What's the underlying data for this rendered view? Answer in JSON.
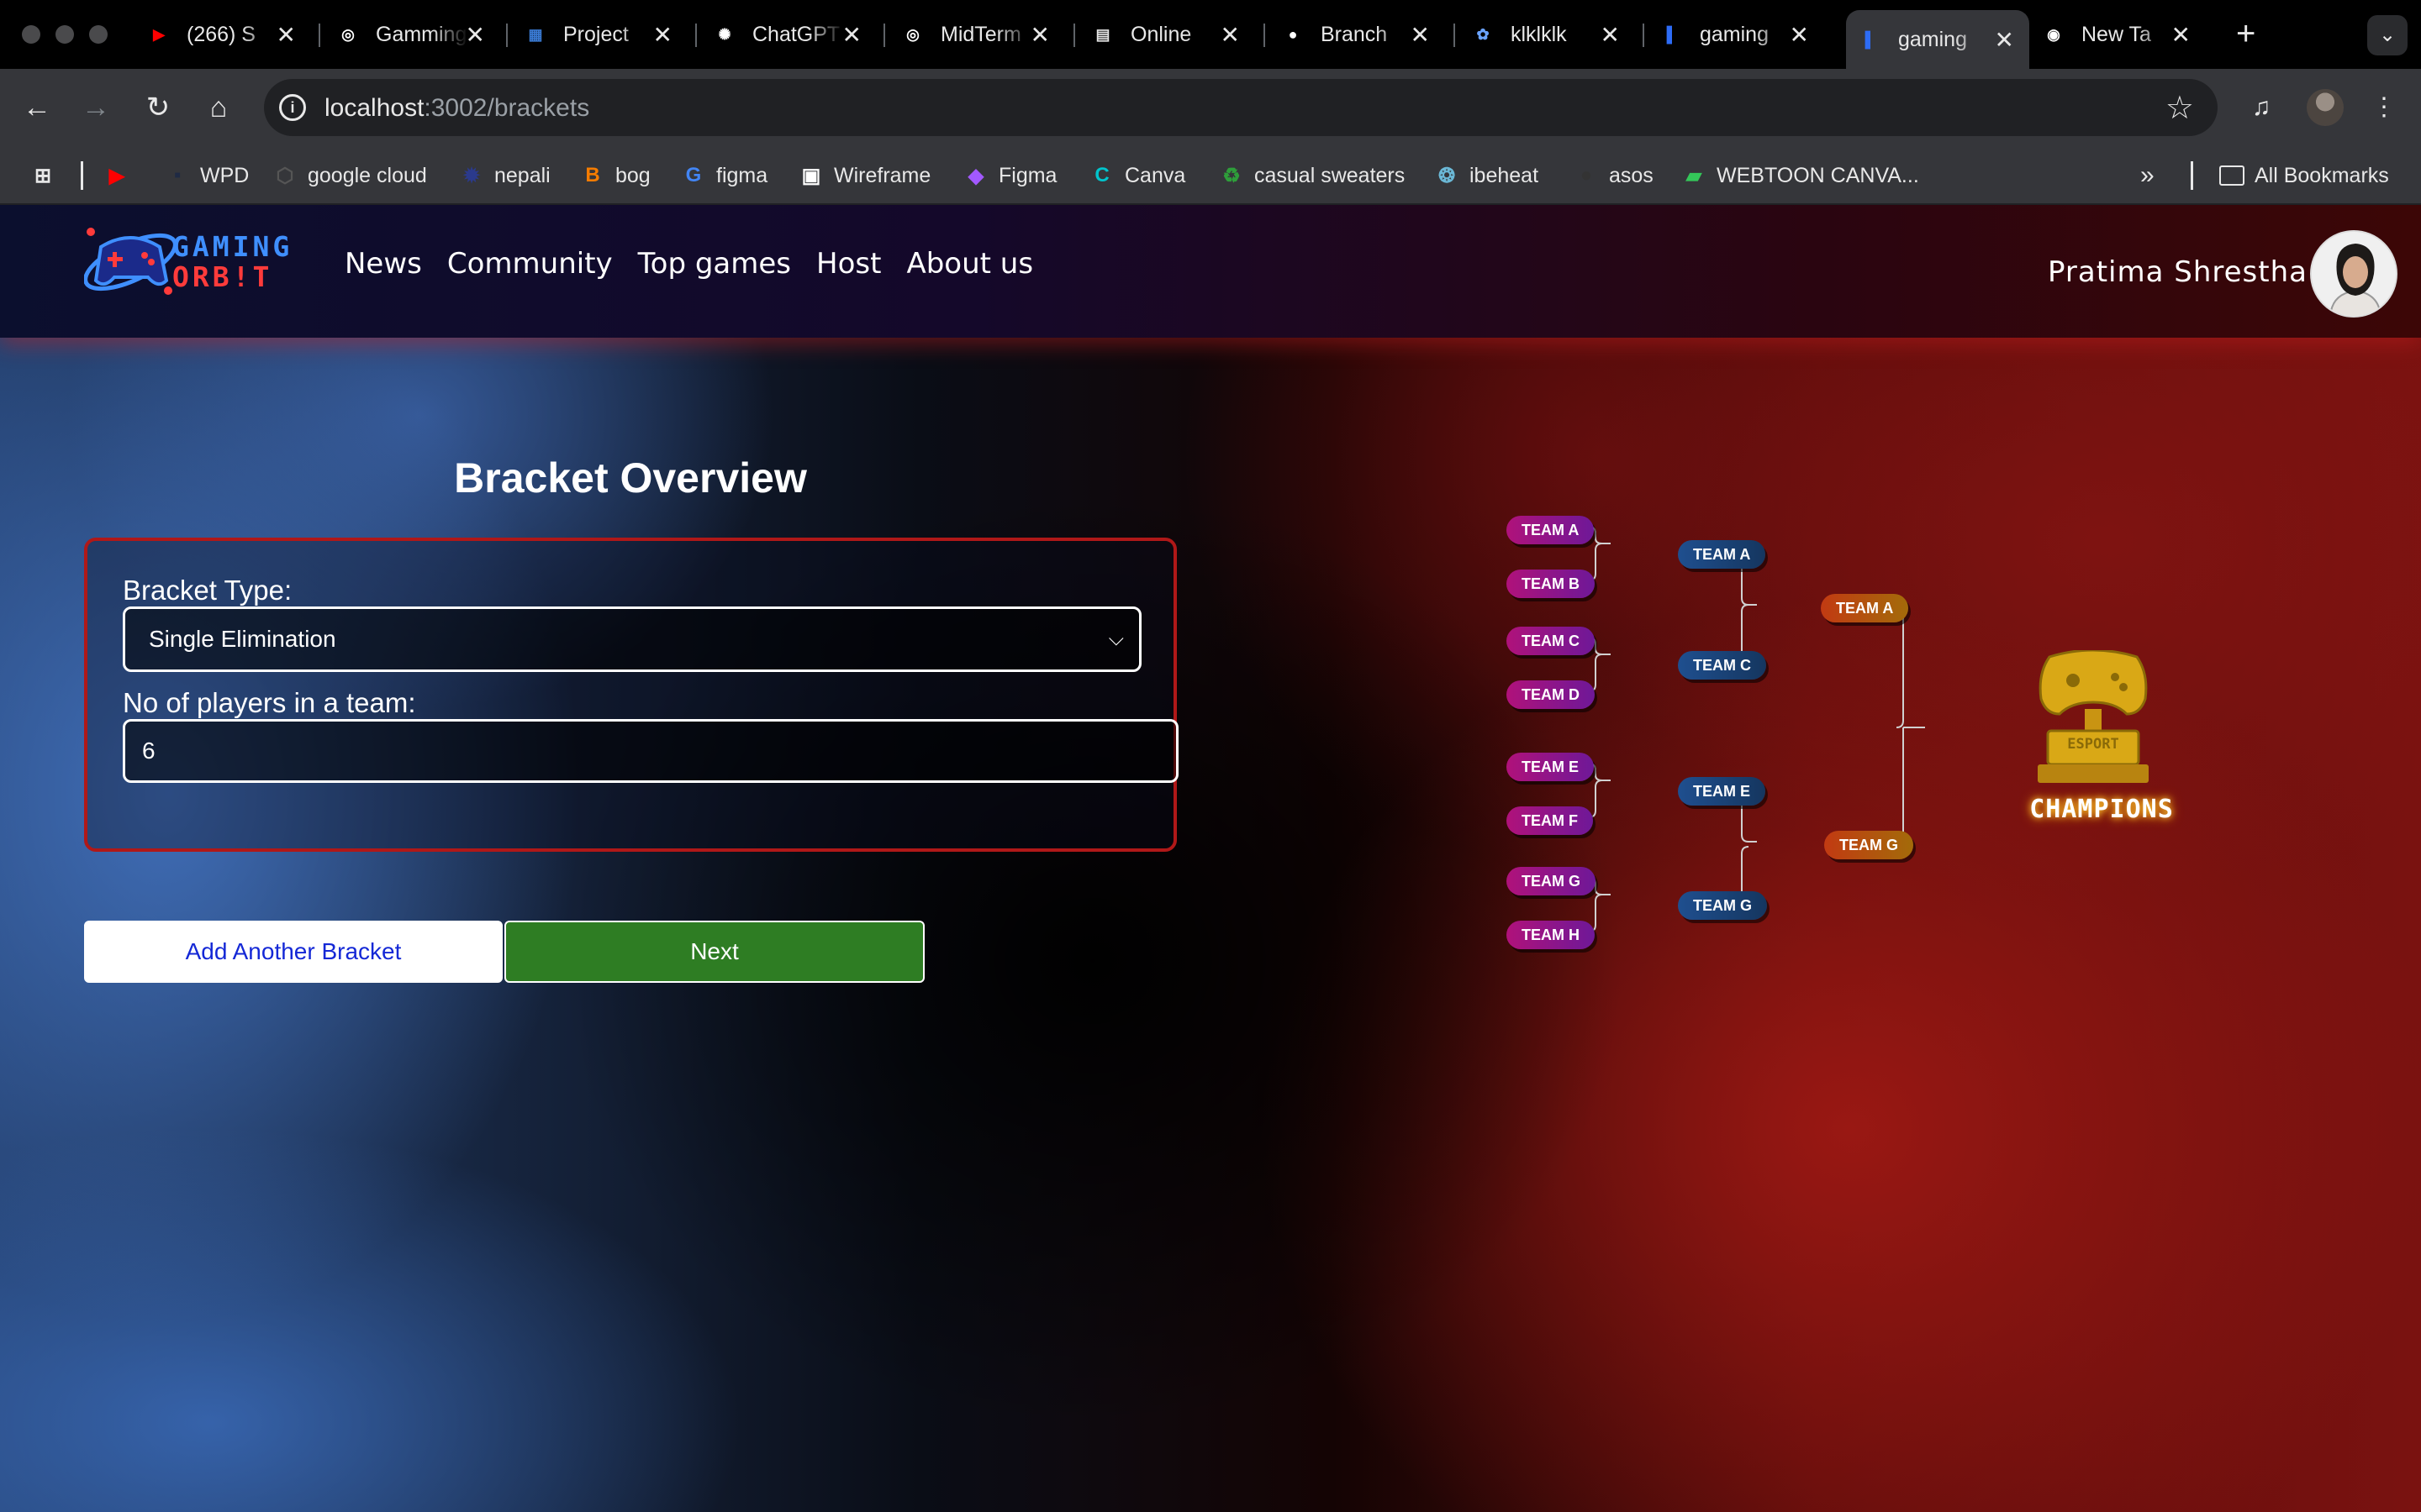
{
  "browser": {
    "tabs": [
      {
        "title": "(266) S",
        "icon": "youtube-icon",
        "color": "#ff0000"
      },
      {
        "title": "Gamming",
        "icon": "spiral-icon",
        "color": "#ffffff"
      },
      {
        "title": "Project",
        "icon": "building-icon",
        "color": "#3a7bd5"
      },
      {
        "title": "ChatGPT",
        "icon": "chatgpt-icon",
        "color": "#ffffff"
      },
      {
        "title": "MidTerm",
        "icon": "spiral-icon",
        "color": "#ffffff"
      },
      {
        "title": "Online",
        "icon": "figma-community-icon",
        "color": "#e6e6e6"
      },
      {
        "title": "Branch",
        "icon": "github-icon",
        "color": "#ffffff"
      },
      {
        "title": "klklklk",
        "icon": "brain-icon",
        "color": "#6aa3ff"
      },
      {
        "title": "gaming",
        "icon": "blue-doc-icon",
        "color": "#2d6cf6"
      },
      {
        "title": "gaming",
        "icon": "blue-doc-icon",
        "color": "#2d6cf6",
        "active": true
      },
      {
        "title": "New Ta",
        "icon": "chrome-icon",
        "color": "#ffffff"
      }
    ],
    "url_host": "localhost",
    "url_path": ":3002/brackets",
    "bookmarks": [
      {
        "label": "",
        "icon": "apps-grid-icon"
      },
      {
        "label": "",
        "icon": "youtube-icon",
        "color": "#ff0000"
      },
      {
        "label": "WPD",
        "icon": "wpd-icon",
        "color": "#1f2a44"
      },
      {
        "label": "google cloud",
        "icon": "cloud-icon",
        "color": "#555"
      },
      {
        "label": "nepali",
        "icon": "nepali-icon",
        "color": "#2b3a8c"
      },
      {
        "label": "bog",
        "icon": "blogger-icon",
        "color": "#f57c00"
      },
      {
        "label": "figma",
        "icon": "google-icon",
        "color": "#4285f4"
      },
      {
        "label": "Wireframe",
        "icon": "wireframe-icon",
        "color": "#ffffff"
      },
      {
        "label": "Figma",
        "icon": "figma-icon",
        "color": "#a259ff"
      },
      {
        "label": "Canva",
        "icon": "canva-icon",
        "color": "#00c4cc"
      },
      {
        "label": "casual sweaters",
        "icon": "recycle-icon",
        "color": "#2e9e3a"
      },
      {
        "label": "ibeheat",
        "icon": "ibeheat-icon",
        "color": "#6bb8d6"
      },
      {
        "label": "asos",
        "icon": "asos-icon",
        "color": "#333333"
      },
      {
        "label": "WEBTOON CANVA...",
        "icon": "webtoon-icon",
        "color": "#34c759"
      }
    ],
    "all_bookmarks": "All Bookmarks"
  },
  "site": {
    "logo_line1": "GAMING",
    "logo_line2": "ORB!T",
    "nav": [
      "News",
      "Community",
      "Top games",
      "Host",
      "About us"
    ],
    "user_name": "Pratima Shrestha"
  },
  "form": {
    "title": "Bracket Overview",
    "bracket_type_label": "Bracket Type:",
    "bracket_type_value": "Single Elimination",
    "players_label": "No of players in a team:",
    "players_value": "6",
    "add_button": "Add Another Bracket",
    "next_button": "Next"
  },
  "bracket": {
    "round1": [
      "TEAM A",
      "TEAM B",
      "TEAM C",
      "TEAM D",
      "TEAM E",
      "TEAM F",
      "TEAM G",
      "TEAM H"
    ],
    "round2": [
      "TEAM A",
      "TEAM C",
      "TEAM E",
      "TEAM G"
    ],
    "round3": [
      "TEAM A",
      "TEAM G"
    ],
    "trophy_label": "ESPORT",
    "champion_label": "CHAMPIONS"
  },
  "colors": {
    "accent_red": "#b01818",
    "next_green": "#2e7d23",
    "add_blue_text": "#1428d6"
  }
}
